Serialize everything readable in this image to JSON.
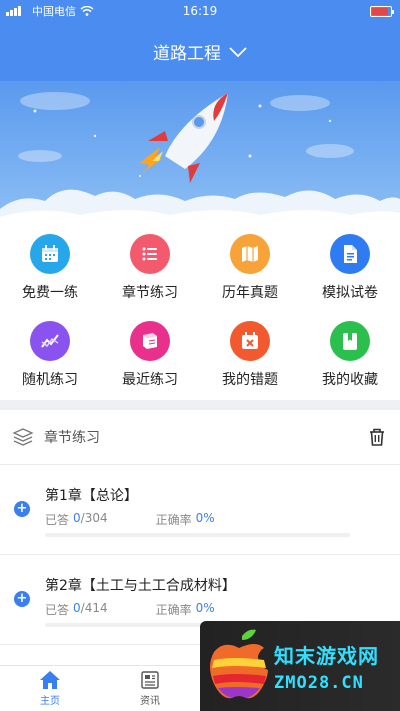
{
  "status_bar": {
    "carrier": "中国电信",
    "time": "16:19"
  },
  "header": {
    "title": "道路工程"
  },
  "quick_actions": [
    {
      "label": "免费一练",
      "icon": "calendar-icon",
      "color": "#26a7e9"
    },
    {
      "label": "章节练习",
      "icon": "list-icon",
      "color": "#f35a6e"
    },
    {
      "label": "历年真题",
      "icon": "map-icon",
      "color": "#f7a33a"
    },
    {
      "label": "模拟试卷",
      "icon": "document-icon",
      "color": "#2f7cf2"
    },
    {
      "label": "随机练习",
      "icon": "chart-line-icon",
      "color": "#8a52ef"
    },
    {
      "label": "最近练习",
      "icon": "book-icon",
      "color": "#e8308c"
    },
    {
      "label": "我的错题",
      "icon": "calendar-x-icon",
      "color": "#f2592f"
    },
    {
      "label": "我的收藏",
      "icon": "bookmark-icon",
      "color": "#2bc04d"
    }
  ],
  "chapter_section": {
    "title": "章节练习",
    "chapters": [
      {
        "name": "第1章【总论】",
        "answered_label": "已答",
        "answered": "0",
        "sep": "/",
        "total": "304",
        "rate_label": "正确率",
        "rate": "0%",
        "progress": 0
      },
      {
        "name": "第2章【土工与土工合成材料】",
        "answered_label": "已答",
        "answered": "0",
        "sep": "/",
        "total": "414",
        "rate_label": "正确率",
        "rate": "0%",
        "progress": 0
      }
    ]
  },
  "tabbar": {
    "tabs": [
      {
        "label": "主页",
        "icon": "home-icon",
        "active": true
      },
      {
        "label": "资讯",
        "icon": "news-icon",
        "active": false
      }
    ]
  },
  "watermark": {
    "cn": "知末游戏网",
    "en": "ZMO28.CN"
  },
  "colors": {
    "primary": "#4a8cf0",
    "accent_blue": "#3a7ff0"
  }
}
